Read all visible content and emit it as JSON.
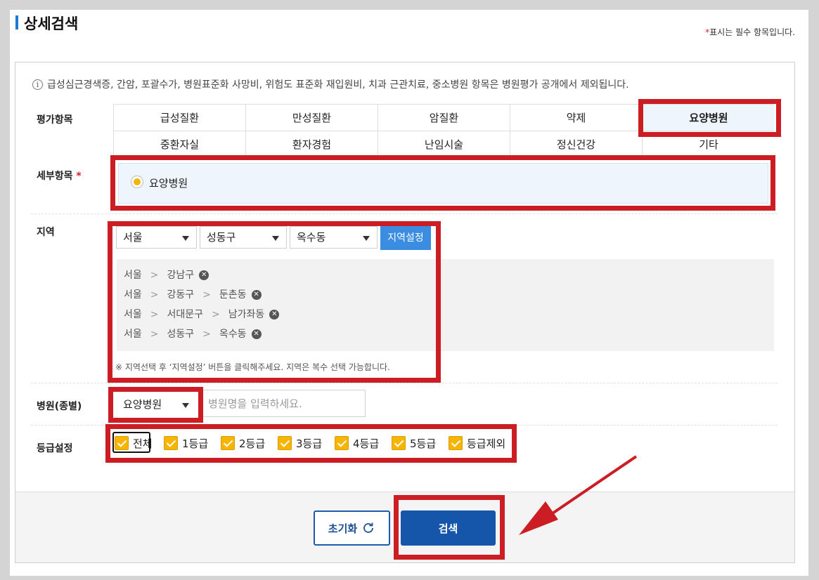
{
  "header": {
    "title": "상세검색",
    "required_star": "*",
    "required_note": "표시는 필수 항목입니다."
  },
  "info": {
    "icon": "i",
    "text": "급성심근경색증, 간암, 포괄수가, 병원표준화 사망비, 위험도 표준화 재입원비, 치과 근관치료, 중소병원 항목은 병원평가 공개에서 제외됩니다."
  },
  "labels": {
    "evaluation": "평가항목",
    "detail": "세부항목",
    "detail_star": "*",
    "region": "지역",
    "hospital_type": "병원(종별)",
    "grade": "등급설정"
  },
  "categories": [
    {
      "label": "급성질환"
    },
    {
      "label": "만성질환"
    },
    {
      "label": "암질환"
    },
    {
      "label": "약제"
    },
    {
      "label": "요양병원"
    },
    {
      "label": "중환자실"
    },
    {
      "label": "환자경험"
    },
    {
      "label": "난임시술"
    },
    {
      "label": "정신건강"
    },
    {
      "label": "기타"
    }
  ],
  "active_category": "요양병원",
  "detail": {
    "selected": "요양병원"
  },
  "region": {
    "sido": "서울",
    "sigungu": "성동구",
    "dong": "옥수동",
    "set_button": "지역설정",
    "separator": ">",
    "selected": [
      {
        "parts": [
          "서울",
          "강남구"
        ]
      },
      {
        "parts": [
          "서울",
          "강동구",
          "둔촌동"
        ]
      },
      {
        "parts": [
          "서울",
          "서대문구",
          "남가좌동"
        ]
      },
      {
        "parts": [
          "서울",
          "성동구",
          "옥수동"
        ]
      }
    ],
    "note": "※ 지역선택 후 ‘지역설정’ 버튼을 클릭해주세요. 지역은 복수 선택 가능합니다."
  },
  "hospital": {
    "type": "요양병원",
    "name_placeholder": "병원명을 입력하세요."
  },
  "grades": [
    {
      "label": "전체",
      "checked": true
    },
    {
      "label": "1등급",
      "checked": true
    },
    {
      "label": "2등급",
      "checked": true
    },
    {
      "label": "3등급",
      "checked": true
    },
    {
      "label": "4등급",
      "checked": true
    },
    {
      "label": "5등급",
      "checked": true
    },
    {
      "label": "등급제외",
      "checked": true
    }
  ],
  "footer": {
    "reset": "초기화",
    "search": "검색"
  },
  "colors": {
    "highlight": "#cc1c24",
    "primary": "#1656aa",
    "accent_blue": "#3a8de0",
    "check": "#f7b500"
  }
}
